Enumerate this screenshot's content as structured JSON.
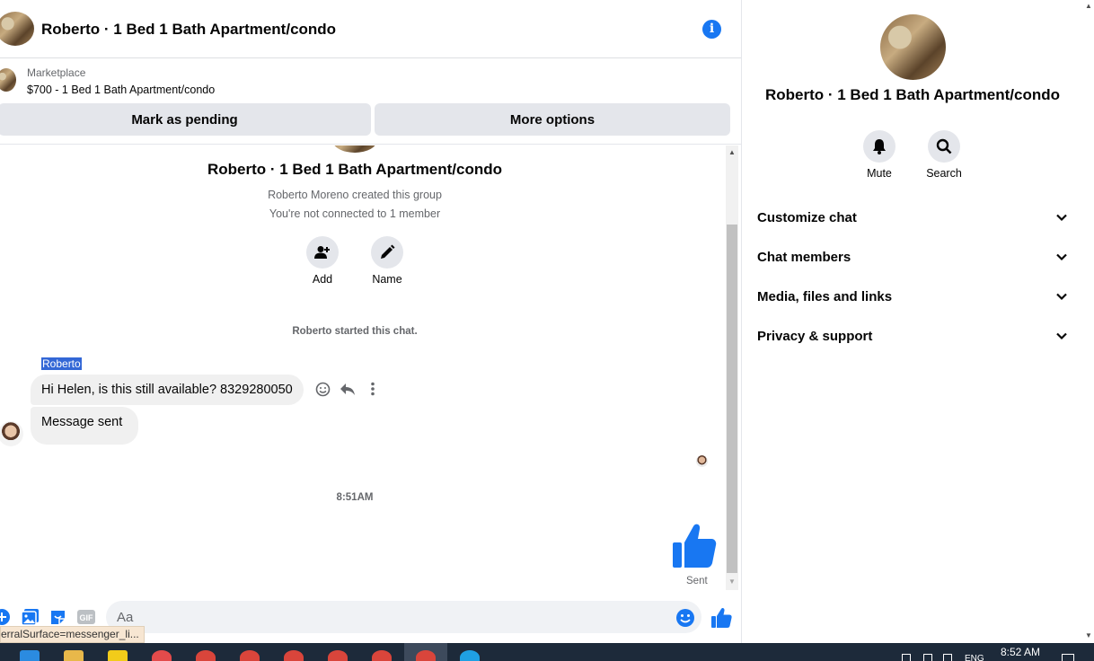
{
  "chat": {
    "title": "Roberto · 1 Bed 1 Bath Apartment/condo",
    "marketplace": {
      "kind": "Marketplace",
      "listing": "$700 - 1 Bed 1 Bath Apartment/condo",
      "mark_pending": "Mark as pending",
      "more_options": "More options"
    },
    "group_title": "Roberto · 1 Bed 1 Bath Apartment/condo",
    "created_by": "Roberto Moreno created this group",
    "not_connected": "You're not connected to 1 member",
    "add_label": "Add",
    "name_label": "Name",
    "started": "Roberto started this chat.",
    "sender_name": "Roberto",
    "messages": [
      "Hi Helen, is this still available? 8329280050",
      "Message sent"
    ],
    "timestamp": "8:51AM",
    "sent_label": "Sent",
    "composer_placeholder": "Aa",
    "status_url": "erralSurface=messenger_li..."
  },
  "side": {
    "title": "Roberto · 1 Bed 1 Bath Apartment/condo",
    "mute_label": "Mute",
    "search_label": "Search",
    "sections": [
      "Customize chat",
      "Chat members",
      "Media, files and links",
      "Privacy & support"
    ]
  },
  "taskbar": {
    "clock": "8:52 AM",
    "lang": "ENG"
  },
  "colors": {
    "accent": "#1877f2",
    "button_bg": "#e4e6eb",
    "bubble_bg": "#f0f0f0"
  },
  "icons": [
    "info-icon",
    "add-person-icon",
    "pencil-icon",
    "smiley-icon",
    "reply-icon",
    "more-vertical-icon",
    "thumbs-up-icon",
    "plus-circle-icon",
    "photo-icon",
    "sticker-icon",
    "gif-icon",
    "bell-icon",
    "search-icon",
    "chevron-down-icon"
  ]
}
